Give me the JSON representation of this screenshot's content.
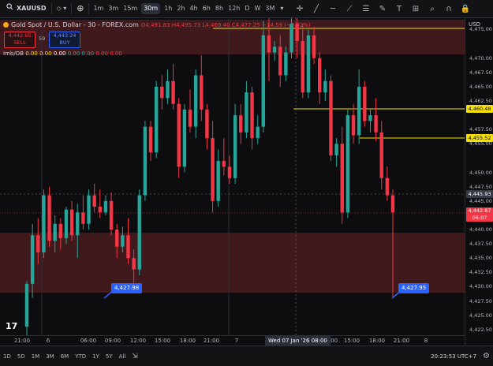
{
  "toolbar": {
    "symbol": "XAUUSD",
    "timeframes": [
      "1m",
      "3m",
      "15m",
      "30m",
      "1h",
      "2h",
      "4h",
      "6h",
      "8h",
      "12h",
      "D",
      "W",
      "3M"
    ],
    "active_timeframe": "30m",
    "draw_tools": [
      "cursor-icon",
      "trend-line-icon",
      "horizontal-line-icon",
      "ray-icon",
      "fib-icon",
      "brush-icon",
      "text-icon",
      "measure-icon",
      "zoom-icon",
      "magnet-icon",
      "lock-icon"
    ]
  },
  "legend": {
    "title": "Gold Spot / U.S. Dollar - 30 - FOREX.com",
    "ohlc": "O4,491.83  H4,495.73  L4,469.40  C4,477.25  −14.59 (−0.32%)",
    "sell_price": "4,442.65",
    "sell_label": "SELL",
    "spread": "59",
    "buy_price": "4,443.24",
    "buy_label": "BUY",
    "indicator_name": "Imb/OB",
    "indicator_values": [
      "0.00",
      "0.00",
      "0.00",
      "0.00",
      "0.00",
      "0.00",
      "0.00"
    ]
  },
  "price_axis": {
    "currency": "USD",
    "ticks": [
      "4,470.00",
      "4,465.00",
      "4,457.50",
      "4,455.00",
      "4,450.00",
      "4,445.00",
      "4,440.00",
      "4,437.50",
      "4,435.00",
      "4,432.50",
      "4,430.00",
      "4,427.50",
      "4,425.00",
      "4,422.50",
      "4,475.00",
      "4,467.50",
      "4,462.50",
      "4,447.50",
      "4,442.50"
    ],
    "tags": {
      "level_high": "4,460.48",
      "level_mid": "4,455.52",
      "crosshair": "4,445.93",
      "last_price": "4,442.87",
      "countdown": "06:07"
    }
  },
  "time_axis": {
    "labels": [
      "21:00",
      "6",
      "06:00",
      "09:00",
      "12:00",
      "15:00",
      "18:00",
      "21:00",
      "7",
      "08:00",
      "12:00",
      "15:00",
      "18:00",
      "21:00",
      "8"
    ],
    "crosshair_label": "Wed 07 Jan '26   08:00"
  },
  "callouts": {
    "left": "4,427.98",
    "right": "4,427.95"
  },
  "bottom_bar": {
    "ranges": [
      "1D",
      "5D",
      "1M",
      "3M",
      "6M",
      "YTD",
      "1Y",
      "5Y",
      "All"
    ],
    "clock": "20:23:53 UTC+7"
  },
  "colors": {
    "up": "#26a69a",
    "down": "#f23645",
    "zone": "#4a1c1f",
    "level_line": "#f5e000",
    "background": "#0d0d0f"
  },
  "chart_data": {
    "type": "candlestick",
    "ylim": [
      4421.5,
      4477
    ],
    "candles": [
      {
        "o": 4423.0,
        "h": 4431.0,
        "l": 4421.5,
        "c": 4430.5
      },
      {
        "o": 4430.5,
        "h": 4441.0,
        "l": 4428.0,
        "c": 4439.0
      },
      {
        "o": 4439.0,
        "h": 4442.0,
        "l": 4434.0,
        "c": 4436.0
      },
      {
        "o": 4436.0,
        "h": 4447.0,
        "l": 4435.0,
        "c": 4446.0
      },
      {
        "o": 4446.0,
        "h": 4447.5,
        "l": 4437.0,
        "c": 4438.0
      },
      {
        "o": 4438.0,
        "h": 4442.5,
        "l": 4436.0,
        "c": 4441.0
      },
      {
        "o": 4441.0,
        "h": 4442.0,
        "l": 4436.5,
        "c": 4438.5
      },
      {
        "o": 4438.5,
        "h": 4444.0,
        "l": 4437.5,
        "c": 4443.5
      },
      {
        "o": 4443.5,
        "h": 4445.0,
        "l": 4438.0,
        "c": 4439.0
      },
      {
        "o": 4439.0,
        "h": 4444.5,
        "l": 4435.0,
        "c": 4443.0
      },
      {
        "o": 4443.0,
        "h": 4446.0,
        "l": 4440.0,
        "c": 4441.0
      },
      {
        "o": 4441.0,
        "h": 4447.0,
        "l": 4440.0,
        "c": 4446.0
      },
      {
        "o": 4446.0,
        "h": 4448.0,
        "l": 4443.0,
        "c": 4444.0
      },
      {
        "o": 4444.0,
        "h": 4447.0,
        "l": 4442.0,
        "c": 4443.0
      },
      {
        "o": 4443.0,
        "h": 4446.0,
        "l": 4442.5,
        "c": 4445.0
      },
      {
        "o": 4445.0,
        "h": 4446.5,
        "l": 4439.0,
        "c": 4440.0
      },
      {
        "o": 4440.0,
        "h": 4441.0,
        "l": 4435.0,
        "c": 4437.0
      },
      {
        "o": 4437.0,
        "h": 4440.5,
        "l": 4436.0,
        "c": 4439.0
      },
      {
        "o": 4439.0,
        "h": 4442.0,
        "l": 4434.0,
        "c": 4435.0
      },
      {
        "o": 4435.0,
        "h": 4436.5,
        "l": 4430.5,
        "c": 4433.0
      },
      {
        "o": 4433.0,
        "h": 4447.0,
        "l": 4432.0,
        "c": 4446.0
      },
      {
        "o": 4446.0,
        "h": 4459.0,
        "l": 4445.0,
        "c": 4458.0
      },
      {
        "o": 4458.0,
        "h": 4459.0,
        "l": 4452.0,
        "c": 4453.5
      },
      {
        "o": 4453.5,
        "h": 4466.0,
        "l": 4452.5,
        "c": 4465.0
      },
      {
        "o": 4465.0,
        "h": 4467.0,
        "l": 4461.0,
        "c": 4463.0
      },
      {
        "o": 4463.0,
        "h": 4468.0,
        "l": 4462.0,
        "c": 4466.0
      },
      {
        "o": 4466.0,
        "h": 4469.0,
        "l": 4461.0,
        "c": 4462.0
      },
      {
        "o": 4462.0,
        "h": 4463.0,
        "l": 4449.0,
        "c": 4451.0
      },
      {
        "o": 4451.0,
        "h": 4462.0,
        "l": 4450.0,
        "c": 4461.0
      },
      {
        "o": 4461.0,
        "h": 4464.5,
        "l": 4457.0,
        "c": 4458.0
      },
      {
        "o": 4458.0,
        "h": 4468.0,
        "l": 4456.0,
        "c": 4467.0
      },
      {
        "o": 4467.0,
        "h": 4470.5,
        "l": 4459.0,
        "c": 4461.0
      },
      {
        "o": 4461.0,
        "h": 4462.0,
        "l": 4454.0,
        "c": 4456.0
      },
      {
        "o": 4456.0,
        "h": 4459.0,
        "l": 4443.0,
        "c": 4445.0
      },
      {
        "o": 4445.0,
        "h": 4454.0,
        "l": 4444.0,
        "c": 4452.0
      },
      {
        "o": 4452.0,
        "h": 4456.0,
        "l": 4449.5,
        "c": 4451.0
      },
      {
        "o": 4451.0,
        "h": 4453.0,
        "l": 4448.0,
        "c": 4449.0
      },
      {
        "o": 4449.0,
        "h": 4462.0,
        "l": 4448.0,
        "c": 4460.0
      },
      {
        "o": 4460.0,
        "h": 4462.0,
        "l": 4455.0,
        "c": 4457.0
      },
      {
        "o": 4457.0,
        "h": 4466.0,
        "l": 4456.0,
        "c": 4464.0
      },
      {
        "o": 4464.0,
        "h": 4465.0,
        "l": 4454.0,
        "c": 4456.0
      },
      {
        "o": 4456.0,
        "h": 4460.0,
        "l": 4455.0,
        "c": 4458.0
      },
      {
        "o": 4458.0,
        "h": 4476.5,
        "l": 4457.0,
        "c": 4474.0
      },
      {
        "o": 4474.0,
        "h": 4477.0,
        "l": 4466.0,
        "c": 4471.0
      },
      {
        "o": 4471.0,
        "h": 4473.0,
        "l": 4469.5,
        "c": 4472.0
      },
      {
        "o": 4472.0,
        "h": 4474.0,
        "l": 4465.0,
        "c": 4467.0
      },
      {
        "o": 4467.0,
        "h": 4472.0,
        "l": 4466.0,
        "c": 4471.0
      },
      {
        "o": 4471.0,
        "h": 4477.0,
        "l": 4470.0,
        "c": 4476.0
      },
      {
        "o": 4476.0,
        "h": 4477.0,
        "l": 4470.0,
        "c": 4473.0
      },
      {
        "o": 4473.0,
        "h": 4476.0,
        "l": 4463.0,
        "c": 4464.0
      },
      {
        "o": 4464.0,
        "h": 4475.0,
        "l": 4463.0,
        "c": 4474.0
      },
      {
        "o": 4474.0,
        "h": 4475.5,
        "l": 4469.0,
        "c": 4470.0
      },
      {
        "o": 4470.0,
        "h": 4471.0,
        "l": 4462.0,
        "c": 4464.0
      },
      {
        "o": 4464.0,
        "h": 4468.0,
        "l": 4462.5,
        "c": 4466.0
      },
      {
        "o": 4466.0,
        "h": 4467.0,
        "l": 4452.0,
        "c": 4453.0
      },
      {
        "o": 4453.0,
        "h": 4456.0,
        "l": 4451.0,
        "c": 4455.0
      },
      {
        "o": 4455.0,
        "h": 4458.0,
        "l": 4441.0,
        "c": 4443.0
      },
      {
        "o": 4443.0,
        "h": 4461.0,
        "l": 4442.0,
        "c": 4460.0
      },
      {
        "o": 4460.0,
        "h": 4462.0,
        "l": 4455.0,
        "c": 4456.5
      },
      {
        "o": 4456.5,
        "h": 4468.0,
        "l": 4455.0,
        "c": 4465.0
      },
      {
        "o": 4465.0,
        "h": 4466.0,
        "l": 4458.0,
        "c": 4459.0
      },
      {
        "o": 4459.0,
        "h": 4461.0,
        "l": 4457.0,
        "c": 4460.0
      },
      {
        "o": 4460.0,
        "h": 4463.0,
        "l": 4455.5,
        "c": 4457.0
      },
      {
        "o": 4457.0,
        "h": 4459.0,
        "l": 4447.0,
        "c": 4449.0
      },
      {
        "o": 4449.0,
        "h": 4451.0,
        "l": 4445.0,
        "c": 4446.0
      },
      {
        "o": 4446.0,
        "h": 4447.0,
        "l": 4428.0,
        "c": 4443.0
      }
    ]
  }
}
